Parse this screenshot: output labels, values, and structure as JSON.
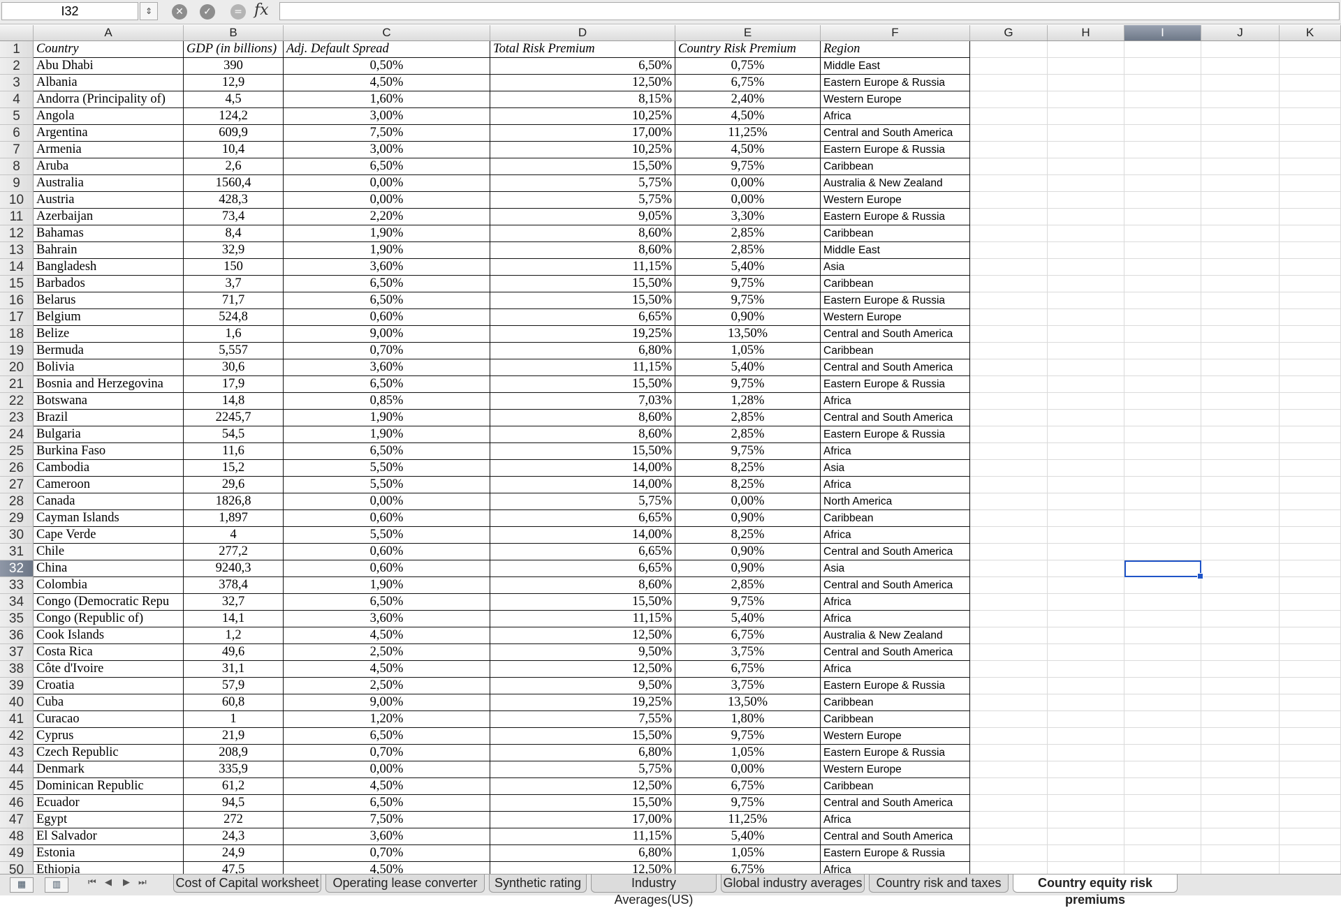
{
  "formula_bar": {
    "name_box": "I32",
    "stepper_icon": "up-down-arrows-icon",
    "cancel_icon": "cancel-x-icon",
    "confirm_icon": "checkmark-icon",
    "fx": "fx",
    "formula_value": ""
  },
  "columns": [
    "A",
    "B",
    "C",
    "D",
    "E",
    "F",
    "G",
    "H",
    "I",
    "J",
    "K"
  ],
  "selected": {
    "row": 32,
    "column": "I"
  },
  "header": {
    "country": "Country",
    "gdp": "GDP (in billions)",
    "spread": "Adj. Default Spread",
    "trp": "Total Risk Premium",
    "crp": "Country Risk Premium",
    "region": "Region"
  },
  "rows": [
    {
      "n": "2",
      "country": "Abu Dhabi",
      "gdp": "390",
      "spread": "0,50%",
      "trp": "6,50%",
      "crp": "0,75%",
      "region": "Middle East"
    },
    {
      "n": "3",
      "country": "Albania",
      "gdp": "12,9",
      "spread": "4,50%",
      "trp": "12,50%",
      "crp": "6,75%",
      "region": "Eastern Europe & Russia"
    },
    {
      "n": "4",
      "country": "Andorra (Principality of)",
      "gdp": "4,5",
      "spread": "1,60%",
      "trp": "8,15%",
      "crp": "2,40%",
      "region": "Western Europe"
    },
    {
      "n": "5",
      "country": "Angola",
      "gdp": "124,2",
      "spread": "3,00%",
      "trp": "10,25%",
      "crp": "4,50%",
      "region": "Africa"
    },
    {
      "n": "6",
      "country": "Argentina",
      "gdp": "609,9",
      "spread": "7,50%",
      "trp": "17,00%",
      "crp": "11,25%",
      "region": "Central and South America"
    },
    {
      "n": "7",
      "country": "Armenia",
      "gdp": "10,4",
      "spread": "3,00%",
      "trp": "10,25%",
      "crp": "4,50%",
      "region": "Eastern Europe & Russia"
    },
    {
      "n": "8",
      "country": "Aruba",
      "gdp": "2,6",
      "spread": "6,50%",
      "trp": "15,50%",
      "crp": "9,75%",
      "region": "Caribbean"
    },
    {
      "n": "9",
      "country": "Australia",
      "gdp": "1560,4",
      "spread": "0,00%",
      "trp": "5,75%",
      "crp": "0,00%",
      "region": "Australia & New Zealand"
    },
    {
      "n": "10",
      "country": "Austria",
      "gdp": "428,3",
      "spread": "0,00%",
      "trp": "5,75%",
      "crp": "0,00%",
      "region": "Western Europe"
    },
    {
      "n": "11",
      "country": "Azerbaijan",
      "gdp": "73,4",
      "spread": "2,20%",
      "trp": "9,05%",
      "crp": "3,30%",
      "region": "Eastern Europe & Russia"
    },
    {
      "n": "12",
      "country": "Bahamas",
      "gdp": "8,4",
      "spread": "1,90%",
      "trp": "8,60%",
      "crp": "2,85%",
      "region": "Caribbean"
    },
    {
      "n": "13",
      "country": "Bahrain",
      "gdp": "32,9",
      "spread": "1,90%",
      "trp": "8,60%",
      "crp": "2,85%",
      "region": "Middle East"
    },
    {
      "n": "14",
      "country": "Bangladesh",
      "gdp": "150",
      "spread": "3,60%",
      "trp": "11,15%",
      "crp": "5,40%",
      "region": "Asia"
    },
    {
      "n": "15",
      "country": "Barbados",
      "gdp": "3,7",
      "spread": "6,50%",
      "trp": "15,50%",
      "crp": "9,75%",
      "region": "Caribbean"
    },
    {
      "n": "16",
      "country": "Belarus",
      "gdp": "71,7",
      "spread": "6,50%",
      "trp": "15,50%",
      "crp": "9,75%",
      "region": "Eastern Europe & Russia"
    },
    {
      "n": "17",
      "country": "Belgium",
      "gdp": "524,8",
      "spread": "0,60%",
      "trp": "6,65%",
      "crp": "0,90%",
      "region": "Western Europe"
    },
    {
      "n": "18",
      "country": "Belize",
      "gdp": "1,6",
      "spread": "9,00%",
      "trp": "19,25%",
      "crp": "13,50%",
      "region": "Central and South America"
    },
    {
      "n": "19",
      "country": "Bermuda",
      "gdp": "5,557",
      "spread": "0,70%",
      "trp": "6,80%",
      "crp": "1,05%",
      "region": "Caribbean"
    },
    {
      "n": "20",
      "country": "Bolivia",
      "gdp": "30,6",
      "spread": "3,60%",
      "trp": "11,15%",
      "crp": "5,40%",
      "region": "Central and South America"
    },
    {
      "n": "21",
      "country": "Bosnia and Herzegovina",
      "gdp": "17,9",
      "spread": "6,50%",
      "trp": "15,50%",
      "crp": "9,75%",
      "region": "Eastern Europe & Russia"
    },
    {
      "n": "22",
      "country": "Botswana",
      "gdp": "14,8",
      "spread": "0,85%",
      "trp": "7,03%",
      "crp": "1,28%",
      "region": "Africa"
    },
    {
      "n": "23",
      "country": "Brazil",
      "gdp": "2245,7",
      "spread": "1,90%",
      "trp": "8,60%",
      "crp": "2,85%",
      "region": "Central and South America"
    },
    {
      "n": "24",
      "country": "Bulgaria",
      "gdp": "54,5",
      "spread": "1,90%",
      "trp": "8,60%",
      "crp": "2,85%",
      "region": "Eastern Europe & Russia"
    },
    {
      "n": "25",
      "country": "Burkina Faso",
      "gdp": "11,6",
      "spread": "6,50%",
      "trp": "15,50%",
      "crp": "9,75%",
      "region": "Africa"
    },
    {
      "n": "26",
      "country": "Cambodia",
      "gdp": "15,2",
      "spread": "5,50%",
      "trp": "14,00%",
      "crp": "8,25%",
      "region": "Asia"
    },
    {
      "n": "27",
      "country": "Cameroon",
      "gdp": "29,6",
      "spread": "5,50%",
      "trp": "14,00%",
      "crp": "8,25%",
      "region": "Africa"
    },
    {
      "n": "28",
      "country": "Canada",
      "gdp": "1826,8",
      "spread": "0,00%",
      "trp": "5,75%",
      "crp": "0,00%",
      "region": "North America"
    },
    {
      "n": "29",
      "country": "Cayman Islands",
      "gdp": "1,897",
      "spread": "0,60%",
      "trp": "6,65%",
      "crp": "0,90%",
      "region": "Caribbean"
    },
    {
      "n": "30",
      "country": "Cape Verde",
      "gdp": "4",
      "spread": "5,50%",
      "trp": "14,00%",
      "crp": "8,25%",
      "region": "Africa"
    },
    {
      "n": "31",
      "country": "Chile",
      "gdp": "277,2",
      "spread": "0,60%",
      "trp": "6,65%",
      "crp": "0,90%",
      "region": "Central and South America"
    },
    {
      "n": "32",
      "country": "China",
      "gdp": "9240,3",
      "spread": "0,60%",
      "trp": "6,65%",
      "crp": "0,90%",
      "region": "Asia"
    },
    {
      "n": "33",
      "country": "Colombia",
      "gdp": "378,4",
      "spread": "1,90%",
      "trp": "8,60%",
      "crp": "2,85%",
      "region": "Central and South America"
    },
    {
      "n": "34",
      "country": "Congo (Democratic Repu",
      "gdp": "32,7",
      "spread": "6,50%",
      "trp": "15,50%",
      "crp": "9,75%",
      "region": "Africa"
    },
    {
      "n": "35",
      "country": "Congo (Republic of)",
      "gdp": "14,1",
      "spread": "3,60%",
      "trp": "11,15%",
      "crp": "5,40%",
      "region": "Africa"
    },
    {
      "n": "36",
      "country": "Cook Islands",
      "gdp": "1,2",
      "spread": "4,50%",
      "trp": "12,50%",
      "crp": "6,75%",
      "region": "Australia & New Zealand"
    },
    {
      "n": "37",
      "country": "Costa Rica",
      "gdp": "49,6",
      "spread": "2,50%",
      "trp": "9,50%",
      "crp": "3,75%",
      "region": "Central and South America"
    },
    {
      "n": "38",
      "country": "Côte d'Ivoire",
      "gdp": "31,1",
      "spread": "4,50%",
      "trp": "12,50%",
      "crp": "6,75%",
      "region": "Africa"
    },
    {
      "n": "39",
      "country": "Croatia",
      "gdp": "57,9",
      "spread": "2,50%",
      "trp": "9,50%",
      "crp": "3,75%",
      "region": "Eastern Europe & Russia"
    },
    {
      "n": "40",
      "country": "Cuba",
      "gdp": "60,8",
      "spread": "9,00%",
      "trp": "19,25%",
      "crp": "13,50%",
      "region": "Caribbean"
    },
    {
      "n": "41",
      "country": "Curacao",
      "gdp": "1",
      "spread": "1,20%",
      "trp": "7,55%",
      "crp": "1,80%",
      "region": "Caribbean"
    },
    {
      "n": "42",
      "country": "Cyprus",
      "gdp": "21,9",
      "spread": "6,50%",
      "trp": "15,50%",
      "crp": "9,75%",
      "region": "Western Europe"
    },
    {
      "n": "43",
      "country": "Czech Republic",
      "gdp": "208,9",
      "spread": "0,70%",
      "trp": "6,80%",
      "crp": "1,05%",
      "region": "Eastern Europe & Russia"
    },
    {
      "n": "44",
      "country": "Denmark",
      "gdp": "335,9",
      "spread": "0,00%",
      "trp": "5,75%",
      "crp": "0,00%",
      "region": "Western Europe"
    },
    {
      "n": "45",
      "country": "Dominican Republic",
      "gdp": "61,2",
      "spread": "4,50%",
      "trp": "12,50%",
      "crp": "6,75%",
      "region": "Caribbean"
    },
    {
      "n": "46",
      "country": "Ecuador",
      "gdp": "94,5",
      "spread": "6,50%",
      "trp": "15,50%",
      "crp": "9,75%",
      "region": "Central and South America"
    },
    {
      "n": "47",
      "country": "Egypt",
      "gdp": "272",
      "spread": "7,50%",
      "trp": "17,00%",
      "crp": "11,25%",
      "region": "Africa"
    },
    {
      "n": "48",
      "country": "El Salvador",
      "gdp": "24,3",
      "spread": "3,60%",
      "trp": "11,15%",
      "crp": "5,40%",
      "region": "Central and South America"
    },
    {
      "n": "49",
      "country": "Estonia",
      "gdp": "24,9",
      "spread": "0,70%",
      "trp": "6,80%",
      "crp": "1,05%",
      "region": "Eastern Europe & Russia"
    },
    {
      "n": "50",
      "country": "Ethiopia",
      "gdp": "47,5",
      "spread": "4,50%",
      "trp": "12,50%",
      "crp": "6,75%",
      "region": "Africa"
    }
  ],
  "sheet_tabs": [
    "Cost of Capital worksheet",
    "Operating lease converter",
    "Synthetic rating",
    "Industry Averages(US)",
    "Global industry averages",
    "Country risk and taxes",
    "Country equity risk premiums"
  ],
  "active_tab": "Country equity risk premiums",
  "tab_nav": {
    "first": "⏮",
    "prev": "◀",
    "next": "▶",
    "last": "⏭"
  },
  "colors": {
    "selection": "#1f54c8",
    "header_selected": "#7a8494"
  }
}
